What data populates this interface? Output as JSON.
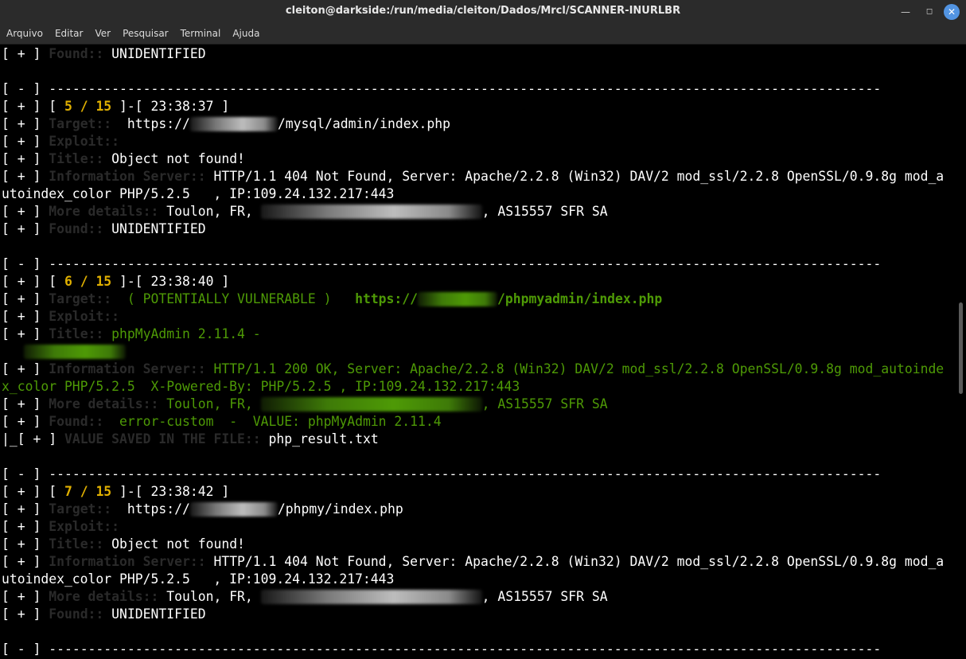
{
  "window": {
    "title": "cleiton@darkside:/run/media/cleiton/Dados/Mrcl/SCANNER-INURLBR",
    "min_symbol": "—",
    "max_symbol": "◻",
    "close_symbol": "✕"
  },
  "menu": [
    "Arquivo",
    "Editar",
    "Ver",
    "Pesquisar",
    "Terminal",
    "Ajuda"
  ],
  "terminal": {
    "prefix_plus": "[ + ] ",
    "prefix_minus": "[ - ] ",
    "prefix_saved": "|_[ + ] ",
    "dashes": "----------------------------------------------------------------------------------------------------------",
    "label_found": "Found:: ",
    "label_target": "Target:: ",
    "label_exploit": "Exploit::",
    "label_title": "Title:: ",
    "label_info": "Information Server:: ",
    "label_more": "More details:: ",
    "label_saved": "VALUE SAVED IN THE FILE:: ",
    "found_unidentified": "UNIDENTIFIED",
    "blocks": [
      {
        "count_open": "[ ",
        "count_value": "5 / 15",
        "count_close": " ]-[ ",
        "time": "23:38:37",
        "time_close": " ]",
        "target_prefix": " https://",
        "target_path": "/mysql/admin/index.php",
        "title": "Object not found!",
        "info_line1": "HTTP/1.1 404 Not Found, Server: Apache/2.2.8 (Win32) DAV/2 mod_ssl/2.2.8 OpenSSL/0.9.8g mod_a",
        "info_line2": "utoindex_color PHP/5.2.5   , IP:109.24.132.217:443",
        "more_prefix": "Toulon, FR, ",
        "more_suffix": ", AS15557 SFR SA",
        "found": "UNIDENTIFIED"
      },
      {
        "count_open": "[ ",
        "count_value": "6 / 15",
        "count_close": " ]-[ ",
        "time": "23:38:40",
        "time_close": " ]",
        "target_status": " ( POTENTIALLY VULNERABLE )   ",
        "target_prefix": "https://",
        "target_path": "/phpmyadmin/index.php",
        "title": "phpMyAdmin 2.11.4 -",
        "info_line1": "HTTP/1.1 200 OK, Server: Apache/2.2.8 (Win32) DAV/2 mod_ssl/2.2.8 OpenSSL/0.9.8g mod_autoinde",
        "info_line2": "x_color PHP/5.2.5  X-Powered-By: PHP/5.2.5 , IP:109.24.132.217:443",
        "more_prefix": "Toulon, FR, ",
        "more_suffix": ", AS15557 SFR SA",
        "found": " error-custom  -  VALUE: phpMyAdmin 2.11.4",
        "saved_file": "php_result.txt"
      },
      {
        "count_open": "[ ",
        "count_value": "7 / 15",
        "count_close": " ]-[ ",
        "time": "23:38:42",
        "time_close": " ]",
        "target_prefix": " https://",
        "target_path": "/phpmy/index.php",
        "title": "Object not found!",
        "info_line1": "HTTP/1.1 404 Not Found, Server: Apache/2.2.8 (Win32) DAV/2 mod_ssl/2.2.8 OpenSSL/0.9.8g mod_a",
        "info_line2": "utoindex_color PHP/5.2.5   , IP:109.24.132.217:443",
        "more_prefix": "Toulon, FR, ",
        "more_suffix": ", AS15557 SFR SA",
        "found": "UNIDENTIFIED"
      }
    ]
  }
}
